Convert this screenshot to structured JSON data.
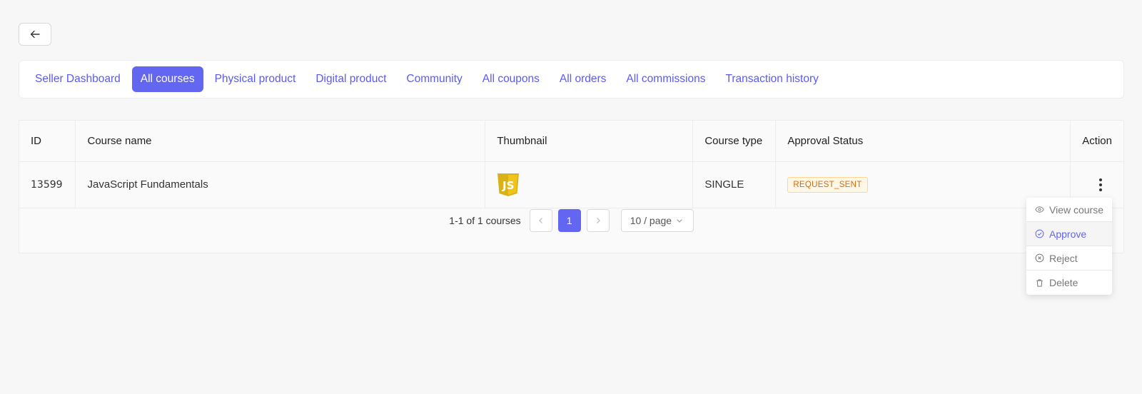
{
  "back_button": {
    "icon": "arrow-left-icon"
  },
  "tabs": [
    {
      "label": "Seller Dashboard",
      "active": false
    },
    {
      "label": "All courses",
      "active": true
    },
    {
      "label": "Physical product",
      "active": false
    },
    {
      "label": "Digital product",
      "active": false
    },
    {
      "label": "Community",
      "active": false
    },
    {
      "label": "All coupons",
      "active": false
    },
    {
      "label": "All orders",
      "active": false
    },
    {
      "label": "All commissions",
      "active": false
    },
    {
      "label": "Transaction history",
      "active": false
    }
  ],
  "table": {
    "headers": {
      "id": "ID",
      "name": "Course name",
      "thumb": "Thumbnail",
      "type": "Course type",
      "status": "Approval Status",
      "action": "Action"
    },
    "rows": [
      {
        "id": "13599",
        "name": "JavaScript Fundamentals",
        "thumbnail_icon": "javascript-logo-icon",
        "type": "SINGLE",
        "status": "REQUEST_SENT"
      }
    ]
  },
  "pagination": {
    "summary": "1-1 of 1 courses",
    "prev": "<",
    "current_page": "1",
    "next": ">",
    "page_size": "10 / page"
  },
  "action_menu": {
    "items": [
      {
        "label": "View course",
        "icon": "eye-icon"
      },
      {
        "label": "Approve",
        "icon": "check-circle-icon"
      },
      {
        "label": "Reject",
        "icon": "x-circle-icon"
      },
      {
        "label": "Delete",
        "icon": "trash-icon"
      }
    ]
  },
  "colors": {
    "accent": "#6366f1",
    "tab_text": "#5b5bf0",
    "status_tag_text": "#d46b08",
    "status_tag_bg": "#fff7e6",
    "js_logo": "#f7df1e"
  }
}
